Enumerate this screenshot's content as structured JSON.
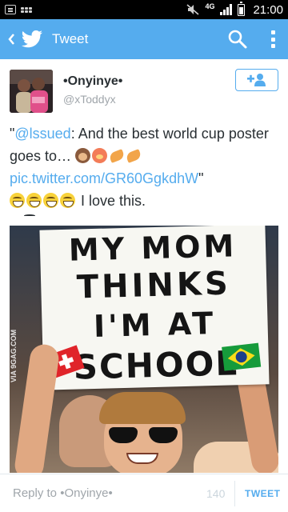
{
  "status_bar": {
    "network": "4G",
    "time": "21:00"
  },
  "action_bar": {
    "title": "Tweet",
    "back_icon": "back-arrow-icon",
    "logo_icon": "twitter-bird-icon",
    "search_icon": "search-icon",
    "overflow_icon": "overflow-menu-icon"
  },
  "tweet": {
    "author_name": "•Onyinye•",
    "author_handle": "@xToddyx",
    "follow_icon": "add-user-icon",
    "text": {
      "open_quote": "\"",
      "mention": "@lssued",
      "body": ": And the best world cup poster goes to… ",
      "link": "pic.twitter.com/GR60GgkdhW",
      "close_quote": "\"",
      "comment": "I love this."
    },
    "emojis_line1": [
      "see-no-evil-monkey",
      "flushed-face",
      "folded-hands",
      "folded-hands"
    ],
    "emojis_line2": [
      "laughing-face",
      "laughing-face",
      "laughing-face",
      "laughing-face"
    ]
  },
  "photo": {
    "sign_lines": [
      "MY MOM",
      "THINKS",
      "I'M AT",
      "SCHOOL"
    ],
    "watermark": "VIA 9GAG.COM"
  },
  "reply_bar": {
    "placeholder": "Reply to •Onyinye•",
    "char_count": "140",
    "tweet_button": "TWEET"
  },
  "colors": {
    "twitter_blue": "#55acee",
    "text_dark": "#292f33",
    "text_muted": "#a0a6ab"
  }
}
